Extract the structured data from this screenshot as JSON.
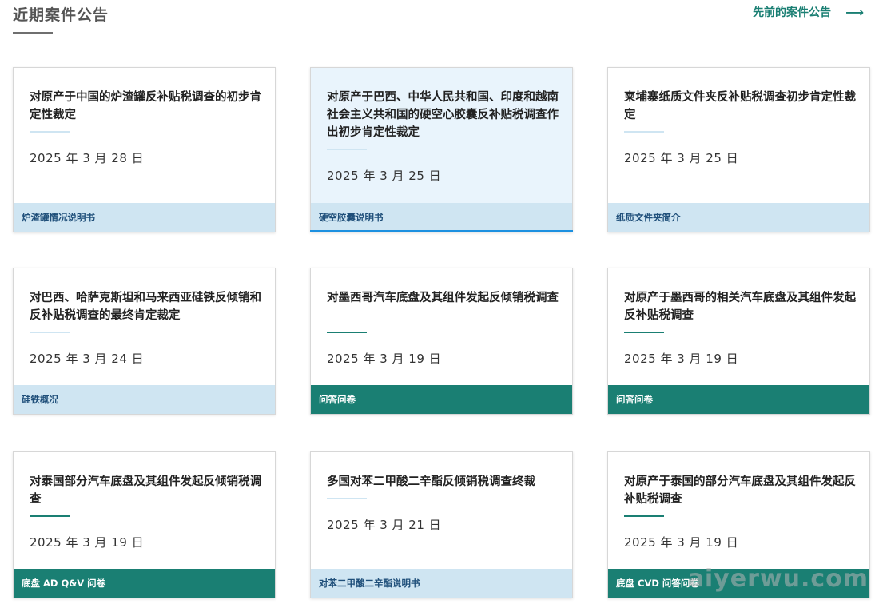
{
  "header": {
    "title": "近期案件公告",
    "prev_link": "先前的案件公告",
    "arrow_icon": "⟶"
  },
  "cards": [
    {
      "title": "对原产于中国的炉渣罐反补贴税调查的初步肯定性裁定",
      "date": "2025 年 3 月 28 日",
      "footer": "炉渣罐情况说明书"
    },
    {
      "title": "对原产于巴西、中华人民共和国、印度和越南社会主义共和国的硬空心胶囊反补贴税调查作出初步肯定性裁定",
      "date": "2025 年 3 月 25 日",
      "footer": "硬空胶囊说明书"
    },
    {
      "title": "柬埔寨纸质文件夹反补贴税调查初步肯定性裁定",
      "date": "2025 年 3 月 25 日",
      "footer": "纸质文件夹简介"
    },
    {
      "title": "对巴西、哈萨克斯坦和马来西亚硅铁反倾销和反补贴税调查的最终肯定裁定",
      "date": "2025 年 3 月 24 日",
      "footer": "硅铁概况"
    },
    {
      "title": "对墨西哥汽车底盘及其组件发起反倾销税调查",
      "date": "2025 年 3 月 19 日",
      "footer": "问答问卷"
    },
    {
      "title": "对原产于墨西哥的相关汽车底盘及其组件发起反补贴税调查",
      "date": "2025 年 3 月 19 日",
      "footer": "问答问卷"
    },
    {
      "title": "对泰国部分汽车底盘及其组件发起反倾销税调查",
      "date": "2025 年 3 月 19 日",
      "footer": "底盘 AD Q&V 问卷"
    },
    {
      "title": "多国对苯二甲酸二辛酯反倾销税调查终裁",
      "date": "2025 年 3 月 21 日",
      "footer": "对苯二甲酸二辛酯说明书"
    },
    {
      "title": "对原产于泰国的部分汽车底盘及其组件发起反补贴税调查",
      "date": "2025 年 3 月 19 日",
      "footer": "底盘 CVD 问答问卷"
    }
  ],
  "watermark": "aiyerwu.com"
}
